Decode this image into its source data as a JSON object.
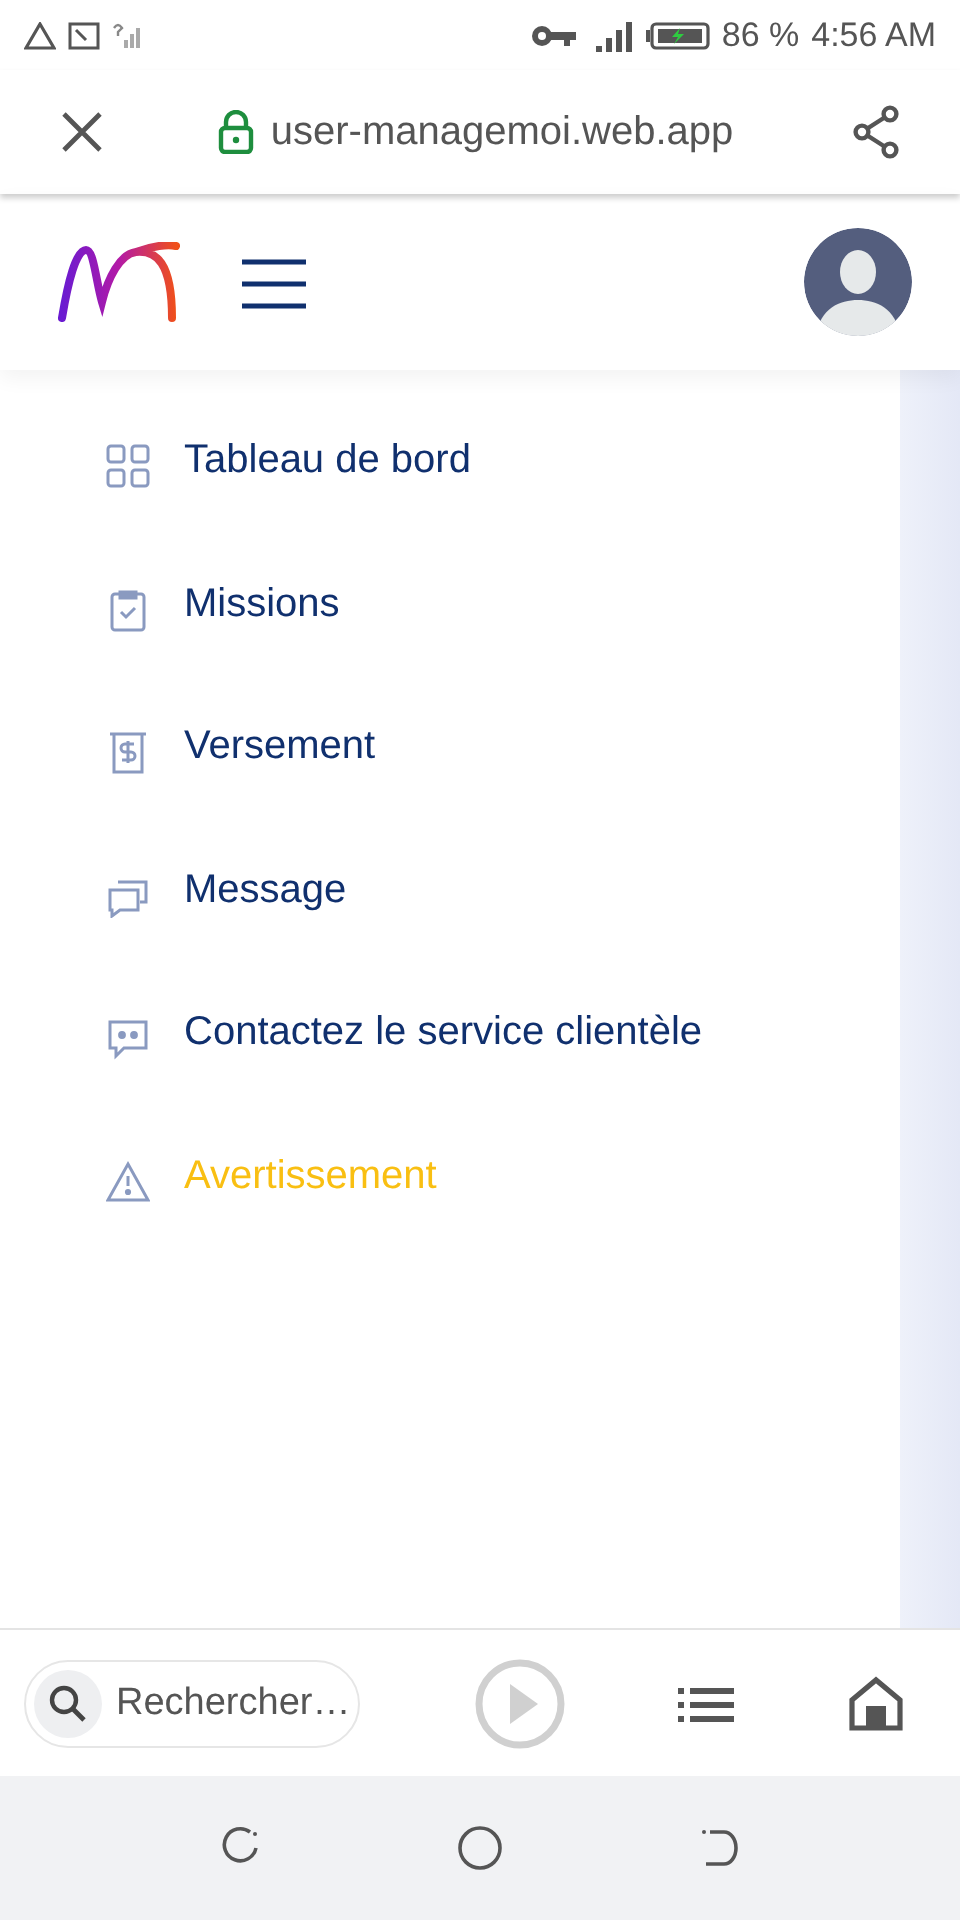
{
  "status_bar": {
    "battery": "86 %",
    "time": "4:56 AM"
  },
  "browser_bar": {
    "url": "user-managemoi.web.app"
  },
  "menu": [
    {
      "label": "Tableau de bord",
      "kind": "grid",
      "highlighted": false
    },
    {
      "label": "Missions",
      "kind": "clipboard",
      "highlighted": false
    },
    {
      "label": "Versement",
      "kind": "receipt",
      "highlighted": false
    },
    {
      "label": "Message",
      "kind": "chat",
      "highlighted": false
    },
    {
      "label": "Contactez le service clientèle",
      "kind": "support",
      "highlighted": false
    },
    {
      "label": "Avertissement",
      "kind": "warning",
      "highlighted": true
    }
  ],
  "bottom_bar": {
    "search": {
      "placeholder": "Rechercher…"
    }
  }
}
